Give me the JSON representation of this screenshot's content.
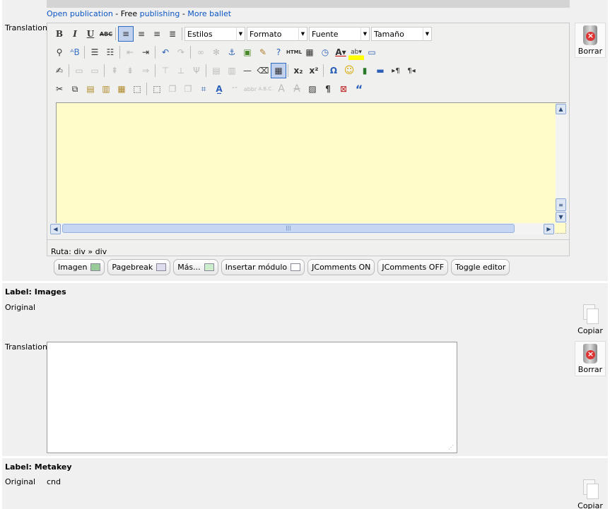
{
  "links": {
    "open_publication": "Open publication",
    "sep1": " - ",
    "free": "Free ",
    "publishing": "publishing",
    "sep2": " - ",
    "more_ballet": "More ballet"
  },
  "translation_label": "Translation",
  "toolbar": {
    "estilos": "Estilos",
    "formato": "Formato",
    "fuente": "Fuente",
    "tamano": "Tamaño",
    "bold": "B",
    "italic": "I",
    "underline": "U",
    "strike": "ABC",
    "html": "HTML",
    "subscript": "x₂",
    "superscript": "x²",
    "omega": "Ω",
    "pilcrow": "¶",
    "quote": "“"
  },
  "path_bar": {
    "label": "Ruta: div » div"
  },
  "editor_buttons": {
    "imagen": "Imagen",
    "pagebreak": "Pagebreak",
    "mas": "Más...",
    "insertar": "Insertar módulo",
    "jc_on": "JComments ON",
    "jc_off": "JComments OFF",
    "toggle": "Toggle editor"
  },
  "borrar": "Borrar",
  "copiar": "Copiar",
  "images_section": {
    "label": "Label: Images",
    "original": "Original",
    "translation": "Translation"
  },
  "metakey_section": {
    "label": "Label: Metakey",
    "original": "Original",
    "original_value": "cnd"
  },
  "colors": {
    "panel": "#f0f0f0",
    "editor_bg": "#fffcc9",
    "link": "#0b55c4"
  }
}
